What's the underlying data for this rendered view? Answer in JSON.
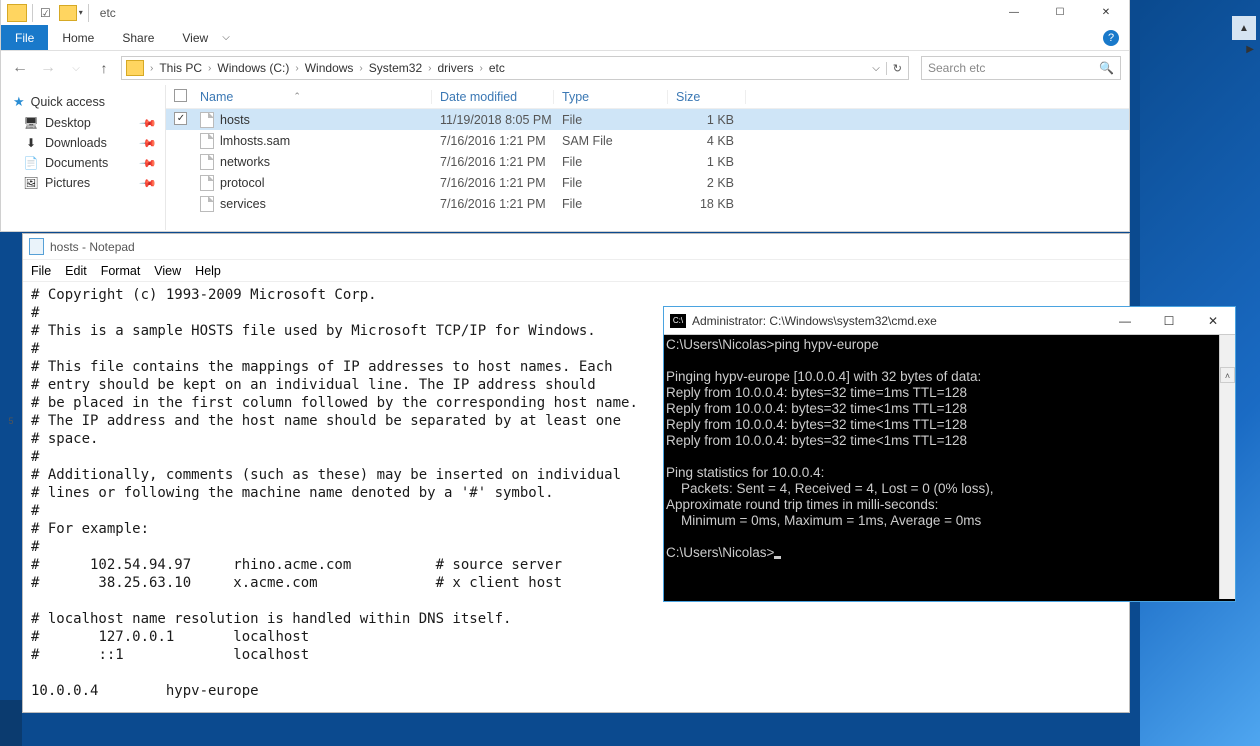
{
  "explorer": {
    "title": "etc",
    "tabs": {
      "file": "File",
      "home": "Home",
      "share": "Share",
      "view": "View"
    },
    "win": {
      "min": "—",
      "max": "☐",
      "close": "✕"
    },
    "breadcrumbs": [
      "This PC",
      "Windows (C:)",
      "Windows",
      "System32",
      "drivers",
      "etc"
    ],
    "search_placeholder": "Search etc",
    "sidebar": {
      "quick_access": "Quick access",
      "items": [
        {
          "label": "Desktop",
          "pinned": true
        },
        {
          "label": "Downloads",
          "pinned": true
        },
        {
          "label": "Documents",
          "pinned": true
        },
        {
          "label": "Pictures",
          "pinned": true
        }
      ]
    },
    "columns": {
      "name": "Name",
      "date": "Date modified",
      "type": "Type",
      "size": "Size"
    },
    "files": [
      {
        "name": "hosts",
        "date": "11/19/2018 8:05 PM",
        "type": "File",
        "size": "1 KB",
        "selected": true
      },
      {
        "name": "lmhosts.sam",
        "date": "7/16/2016 1:21 PM",
        "type": "SAM File",
        "size": "4 KB",
        "selected": false
      },
      {
        "name": "networks",
        "date": "7/16/2016 1:21 PM",
        "type": "File",
        "size": "1 KB",
        "selected": false
      },
      {
        "name": "protocol",
        "date": "7/16/2016 1:21 PM",
        "type": "File",
        "size": "2 KB",
        "selected": false
      },
      {
        "name": "services",
        "date": "7/16/2016 1:21 PM",
        "type": "File",
        "size": "18 KB",
        "selected": false
      }
    ]
  },
  "notepad": {
    "title": "hosts - Notepad",
    "menu": {
      "file": "File",
      "edit": "Edit",
      "format": "Format",
      "view": "View",
      "help": "Help"
    },
    "content": "# Copyright (c) 1993-2009 Microsoft Corp.\n#\n# This is a sample HOSTS file used by Microsoft TCP/IP for Windows.\n#\n# This file contains the mappings of IP addresses to host names. Each\n# entry should be kept on an individual line. The IP address should\n# be placed in the first column followed by the corresponding host name.\n# The IP address and the host name should be separated by at least one\n# space.\n#\n# Additionally, comments (such as these) may be inserted on individual\n# lines or following the machine name denoted by a '#' symbol.\n#\n# For example:\n#\n#      102.54.94.97     rhino.acme.com          # source server\n#       38.25.63.10     x.acme.com              # x client host\n\n# localhost name resolution is handled within DNS itself.\n#\t127.0.0.1       localhost\n#\t::1             localhost\n\n10.0.0.4        hypv-europe"
  },
  "cmd": {
    "title": "Administrator: C:\\Windows\\system32\\cmd.exe",
    "output": "C:\\Users\\Nicolas>ping hypv-europe\n\nPinging hypv-europe [10.0.0.4] with 32 bytes of data:\nReply from 10.0.0.4: bytes=32 time=1ms TTL=128\nReply from 10.0.0.4: bytes=32 time<1ms TTL=128\nReply from 10.0.0.4: bytes=32 time<1ms TTL=128\nReply from 10.0.0.4: bytes=32 time<1ms TTL=128\n\nPing statistics for 10.0.0.4:\n    Packets: Sent = 4, Received = 4, Lost = 0 (0% loss),\nApproximate round trip times in milli-seconds:\n    Minimum = 0ms, Maximum = 1ms, Average = 0ms\n\nC:\\Users\\Nicolas>"
  },
  "gutter_line": "5"
}
